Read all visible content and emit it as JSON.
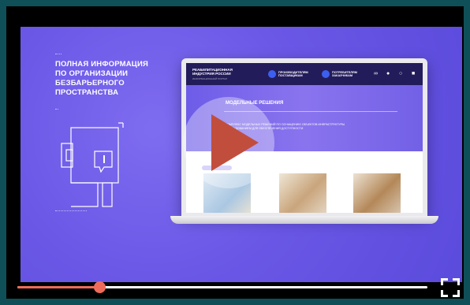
{
  "player": {
    "progress": 0.2,
    "play_icon": "play-icon",
    "fullscreen_icon": "fullscreen-icon",
    "accent_color": "#ef6b59"
  },
  "promo": {
    "heading": "ПОЛНАЯ ИНФОРМАЦИЯ\nПО ОРГАНИЗАЦИИ\nБЕЗБАРЬЕРНОГО\nПРОСТРАНСТВА",
    "illustration_icon": "floor-plan-info-icon"
  },
  "site": {
    "logo": "РЕАБИЛИТАЦИОННАЯ\nИНДУСТРИЯ РОССИИ",
    "logo_sub": "ИНФОРМАЦИОННЫЙ ПОРТАЛ",
    "nav": [
      {
        "label": "ПРОИЗВОДИТЕЛЯМ\nПОСТАВЩИКАМ"
      },
      {
        "label": "ПОТРЕБИТЕЛЯМ\nЗАКАЗЧИКАМ"
      }
    ],
    "header_icons": [
      "accessibility-glasses-icon",
      "user-icon",
      "search-icon",
      "menu-icon"
    ],
    "hero_title": "МОДЕЛЬНЫЕ РЕШЕНИЯ",
    "hero_subtitle": "КОМПЛЕКС МОДЕЛЬНЫХ РЕШЕНИЙ ПО ОСНАЩЕНИЮ ОБЪЕКТОВ ИНФРАСТРУКТУРЫ ОБОРУДОВАНИЕМ ДЛЯ ОБЕСПЕЧЕНИЯ ДОСТУПНОСТИ"
  }
}
